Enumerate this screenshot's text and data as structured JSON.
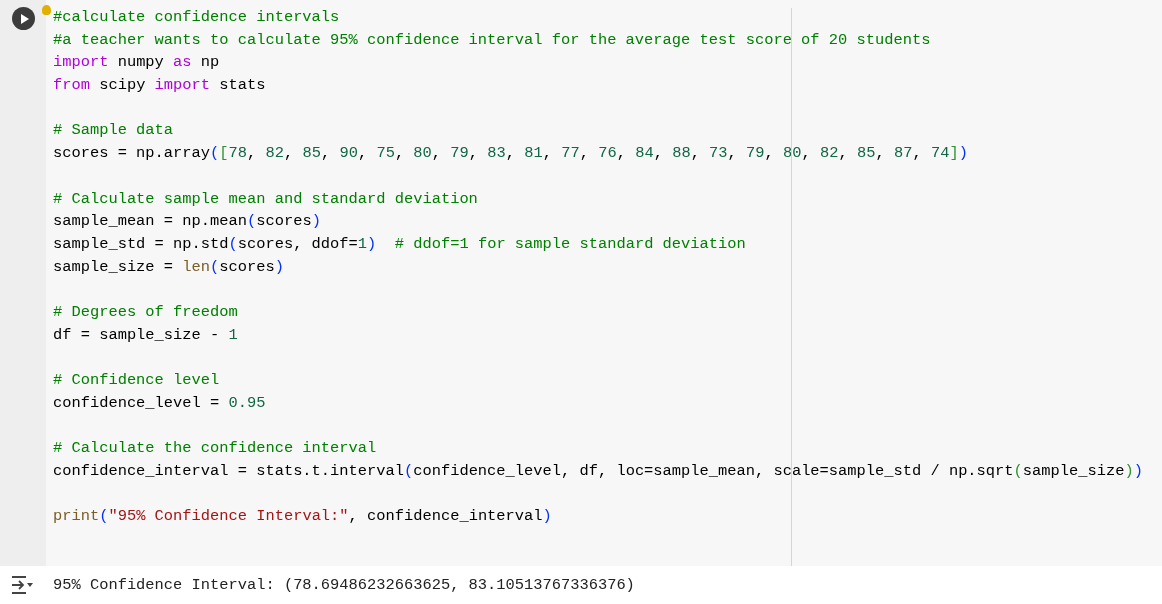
{
  "cell": {
    "code_lines": [
      {
        "kind": "code",
        "tokens": [
          {
            "kind": "comment",
            "text": "#calculate confidence intervals"
          }
        ]
      },
      {
        "kind": "code",
        "tokens": [
          {
            "kind": "comment",
            "text": "#a teacher wants to calculate 95% confidence interval for the average test score of 20 students"
          }
        ]
      },
      {
        "kind": "code",
        "tokens": [
          {
            "kind": "keyword",
            "text": "import"
          },
          {
            "kind": "plain",
            "text": " numpy "
          },
          {
            "kind": "keyword",
            "text": "as"
          },
          {
            "kind": "plain",
            "text": " np"
          }
        ]
      },
      {
        "kind": "code",
        "tokens": [
          {
            "kind": "keyword",
            "text": "from"
          },
          {
            "kind": "plain",
            "text": " scipy "
          },
          {
            "kind": "keyword",
            "text": "import"
          },
          {
            "kind": "plain",
            "text": " stats"
          }
        ]
      },
      {
        "kind": "blank"
      },
      {
        "kind": "code",
        "tokens": [
          {
            "kind": "comment",
            "text": "# Sample data"
          }
        ]
      },
      {
        "kind": "code",
        "tokens": [
          {
            "kind": "plain",
            "text": "scores = np.array"
          },
          {
            "kind": "paren",
            "text": "("
          },
          {
            "kind": "bracket",
            "text": "["
          },
          {
            "kind": "number",
            "text": "78"
          },
          {
            "kind": "plain",
            "text": ", "
          },
          {
            "kind": "number",
            "text": "82"
          },
          {
            "kind": "plain",
            "text": ", "
          },
          {
            "kind": "number",
            "text": "85"
          },
          {
            "kind": "plain",
            "text": ", "
          },
          {
            "kind": "number",
            "text": "90"
          },
          {
            "kind": "plain",
            "text": ", "
          },
          {
            "kind": "number",
            "text": "75"
          },
          {
            "kind": "plain",
            "text": ", "
          },
          {
            "kind": "number",
            "text": "80"
          },
          {
            "kind": "plain",
            "text": ", "
          },
          {
            "kind": "number",
            "text": "79"
          },
          {
            "kind": "plain",
            "text": ", "
          },
          {
            "kind": "number",
            "text": "83"
          },
          {
            "kind": "plain",
            "text": ", "
          },
          {
            "kind": "number",
            "text": "81"
          },
          {
            "kind": "plain",
            "text": ", "
          },
          {
            "kind": "number",
            "text": "77"
          },
          {
            "kind": "plain",
            "text": ", "
          },
          {
            "kind": "number",
            "text": "76"
          },
          {
            "kind": "plain",
            "text": ", "
          },
          {
            "kind": "number",
            "text": "84"
          },
          {
            "kind": "plain",
            "text": ", "
          },
          {
            "kind": "number",
            "text": "88"
          },
          {
            "kind": "plain",
            "text": ", "
          },
          {
            "kind": "number",
            "text": "73"
          },
          {
            "kind": "plain",
            "text": ", "
          },
          {
            "kind": "number",
            "text": "79"
          },
          {
            "kind": "plain",
            "text": ", "
          },
          {
            "kind": "number",
            "text": "80"
          },
          {
            "kind": "plain",
            "text": ", "
          },
          {
            "kind": "number",
            "text": "82"
          },
          {
            "kind": "plain",
            "text": ", "
          },
          {
            "kind": "number",
            "text": "85"
          },
          {
            "kind": "plain",
            "text": ", "
          },
          {
            "kind": "number",
            "text": "87"
          },
          {
            "kind": "plain",
            "text": ", "
          },
          {
            "kind": "number",
            "text": "74"
          },
          {
            "kind": "bracket",
            "text": "]"
          },
          {
            "kind": "paren",
            "text": ")"
          }
        ]
      },
      {
        "kind": "blank"
      },
      {
        "kind": "code",
        "tokens": [
          {
            "kind": "comment",
            "text": "# Calculate sample mean and standard deviation"
          }
        ]
      },
      {
        "kind": "code",
        "tokens": [
          {
            "kind": "plain",
            "text": "sample_mean = np.mean"
          },
          {
            "kind": "paren",
            "text": "("
          },
          {
            "kind": "plain",
            "text": "scores"
          },
          {
            "kind": "paren",
            "text": ")"
          }
        ]
      },
      {
        "kind": "code",
        "tokens": [
          {
            "kind": "plain",
            "text": "sample_std = np.std"
          },
          {
            "kind": "paren",
            "text": "("
          },
          {
            "kind": "plain",
            "text": "scores, ddof="
          },
          {
            "kind": "number",
            "text": "1"
          },
          {
            "kind": "paren",
            "text": ")"
          },
          {
            "kind": "comment",
            "text": "  # ddof=1 for sample standard deviation"
          }
        ]
      },
      {
        "kind": "code",
        "tokens": [
          {
            "kind": "plain",
            "text": "sample_size = "
          },
          {
            "kind": "builtin",
            "text": "len"
          },
          {
            "kind": "paren",
            "text": "("
          },
          {
            "kind": "plain",
            "text": "scores"
          },
          {
            "kind": "paren",
            "text": ")"
          }
        ]
      },
      {
        "kind": "blank"
      },
      {
        "kind": "code",
        "tokens": [
          {
            "kind": "comment",
            "text": "# Degrees of freedom"
          }
        ]
      },
      {
        "kind": "code",
        "tokens": [
          {
            "kind": "plain",
            "text": "df = sample_size - "
          },
          {
            "kind": "number",
            "text": "1"
          }
        ]
      },
      {
        "kind": "blank"
      },
      {
        "kind": "code",
        "tokens": [
          {
            "kind": "comment",
            "text": "# Confidence level"
          }
        ]
      },
      {
        "kind": "code",
        "tokens": [
          {
            "kind": "plain",
            "text": "confidence_level = "
          },
          {
            "kind": "number",
            "text": "0.95"
          }
        ]
      },
      {
        "kind": "blank"
      },
      {
        "kind": "code",
        "tokens": [
          {
            "kind": "comment",
            "text": "# Calculate the confidence interval"
          }
        ]
      },
      {
        "kind": "code",
        "tokens": [
          {
            "kind": "plain",
            "text": "confidence_interval = stats.t.interval"
          },
          {
            "kind": "paren",
            "text": "("
          },
          {
            "kind": "plain",
            "text": "confidence_level, df, loc=sample_mean, scale=sample_std / np.sqrt"
          },
          {
            "kind": "bracket",
            "text": "("
          },
          {
            "kind": "plain",
            "text": "sample_size"
          },
          {
            "kind": "bracket",
            "text": ")"
          },
          {
            "kind": "paren",
            "text": ")"
          }
        ]
      },
      {
        "kind": "blank"
      },
      {
        "kind": "code",
        "tokens": [
          {
            "kind": "builtin",
            "text": "print"
          },
          {
            "kind": "paren",
            "text": "("
          },
          {
            "kind": "string",
            "text": "\"95% Confidence Interval:\""
          },
          {
            "kind": "plain",
            "text": ", confidence_interval"
          },
          {
            "kind": "paren",
            "text": ")"
          }
        ]
      }
    ]
  },
  "output": {
    "text": "95% Confidence Interval: (78.69486232663625, 83.10513767336376)"
  }
}
